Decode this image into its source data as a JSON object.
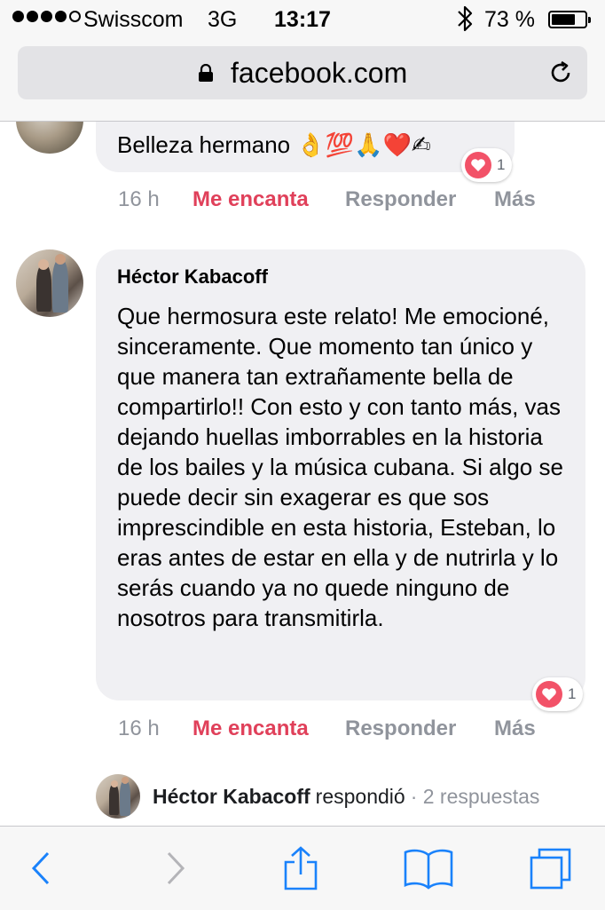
{
  "status_bar": {
    "carrier": "Swisscom",
    "network": "3G",
    "time": "13:17",
    "battery_percent": "73 %",
    "battery_level": 0.73,
    "signal_bars": 4
  },
  "browser": {
    "url": "facebook.com",
    "icons": [
      "lock-icon",
      "reload-icon",
      "back-icon",
      "forward-icon",
      "share-icon",
      "bookmarks-icon",
      "tabs-icon"
    ]
  },
  "comments": [
    {
      "text": "Belleza hermano 👌💯🙏❤️✍",
      "reaction_count": "1",
      "time": "16 h",
      "love_label": "Me encanta",
      "reply_label": "Responder",
      "more_label": "Más"
    },
    {
      "author": "Héctor Kabacoff",
      "text": "Que hermosura este relato! Me emocioné, sinceramente. Que momento tan único y que manera tan extrañamente bella de compartirlo!! Con esto y con tanto más, vas dejando huellas imborrables en la historia de los bailes y la música cubana. Si algo se puede decir sin exagerar es que sos imprescindible en esta historia, Esteban, lo eras antes de estar en ella y de nutrirla y lo serás cuando ya no quede ninguno de nosotros para transmitirla.",
      "reaction_count": "1",
      "time": "16 h",
      "love_label": "Me encanta",
      "reply_label": "Responder",
      "more_label": "Más"
    }
  ],
  "replies_summary": {
    "name": "Héctor Kabacoff",
    "verb": "respondió",
    "count": "· 2 respuestas"
  },
  "colors": {
    "love": "#e0405a",
    "heart_badge": "#f25268",
    "ios_blue": "#1a82fb",
    "meta_gray": "#90949c",
    "bubble": "#f0f0f3"
  }
}
